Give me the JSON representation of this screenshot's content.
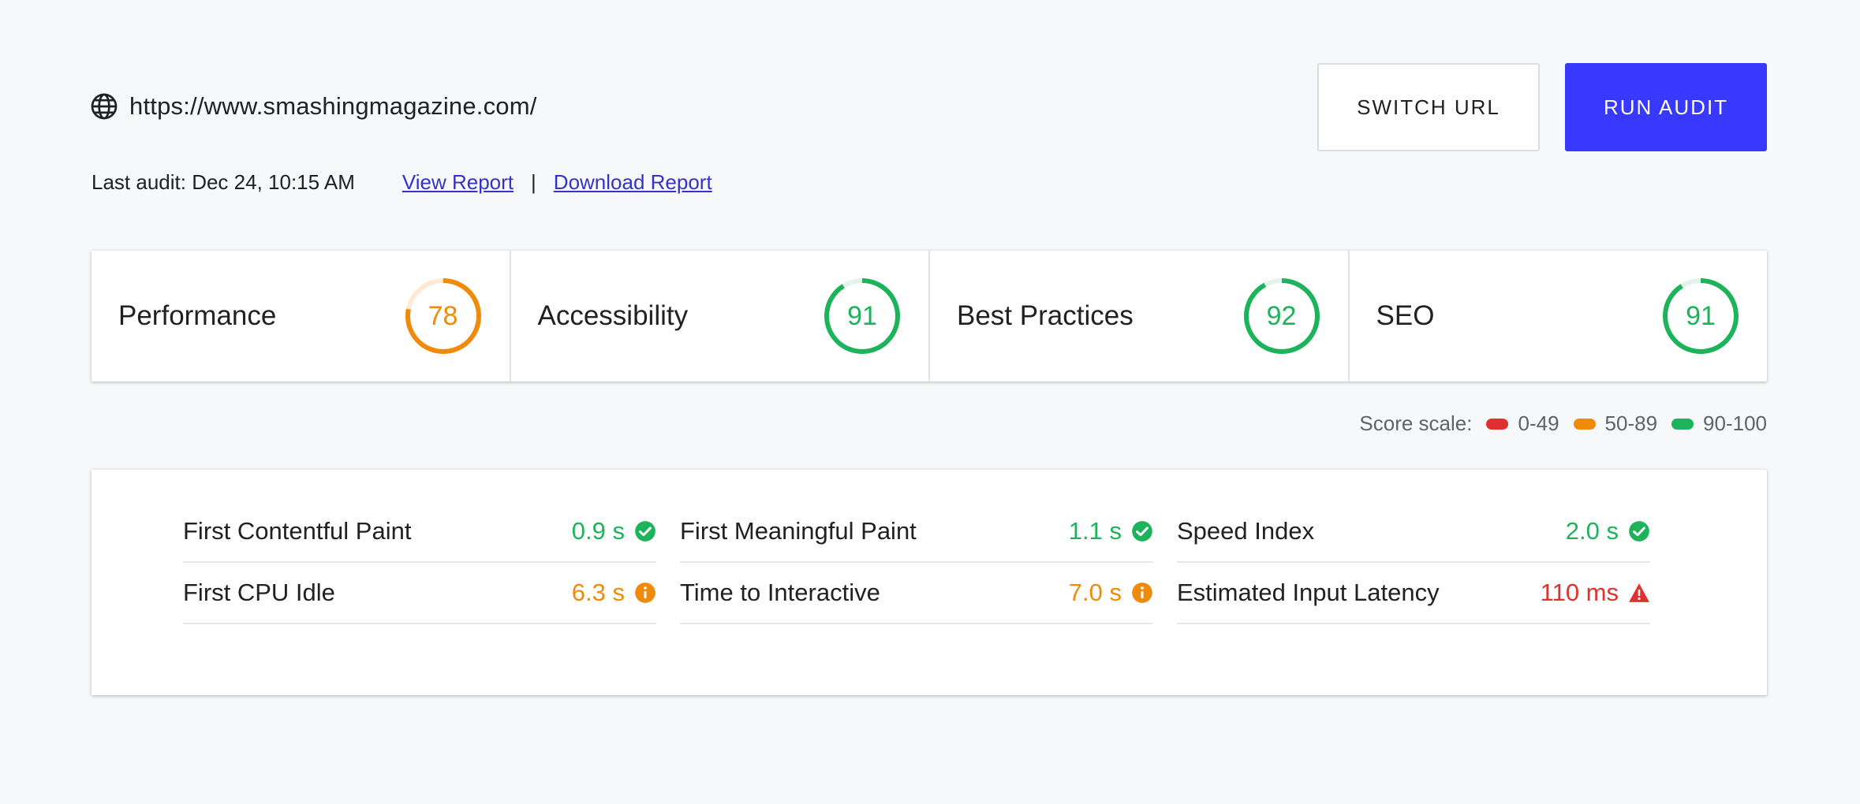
{
  "header": {
    "url": "https://www.smashingmagazine.com/",
    "last_audit": "Last audit: Dec 24, 10:15 AM",
    "view_report": "View Report ",
    "separator": "|",
    "download_report": "Download Report",
    "switch_url_label": "SWITCH URL",
    "run_audit_label": "RUN AUDIT"
  },
  "colors": {
    "accent": "#3838ff",
    "good": "#1db35a",
    "average": "#f08a0b",
    "poor": "#e03131"
  },
  "scores": [
    {
      "label": "Performance",
      "score": 78,
      "status": "average"
    },
    {
      "label": "Accessibility",
      "score": 91,
      "status": "good"
    },
    {
      "label": "Best Practices",
      "score": 92,
      "status": "good"
    },
    {
      "label": "SEO",
      "score": 91,
      "status": "good"
    }
  ],
  "scale": {
    "label": "Score scale:",
    "ranges": [
      {
        "label": "0-49",
        "status": "poor"
      },
      {
        "label": "50-89",
        "status": "average"
      },
      {
        "label": "90-100",
        "status": "good"
      }
    ]
  },
  "metrics": [
    {
      "name": "First Contentful Paint",
      "value": "0.9 s",
      "status": "good",
      "icon": "check-circle-icon"
    },
    {
      "name": "First Meaningful Paint",
      "value": "1.1 s",
      "status": "good",
      "icon": "check-circle-icon"
    },
    {
      "name": "Speed Index",
      "value": "2.0 s",
      "status": "good",
      "icon": "check-circle-icon"
    },
    {
      "name": "First CPU Idle",
      "value": "6.3 s",
      "status": "average",
      "icon": "info-circle-icon"
    },
    {
      "name": "Time to Interactive",
      "value": "7.0 s",
      "status": "average",
      "icon": "info-circle-icon"
    },
    {
      "name": "Estimated Input Latency",
      "value": "110 ms",
      "status": "poor",
      "icon": "warning-triangle-icon"
    }
  ]
}
